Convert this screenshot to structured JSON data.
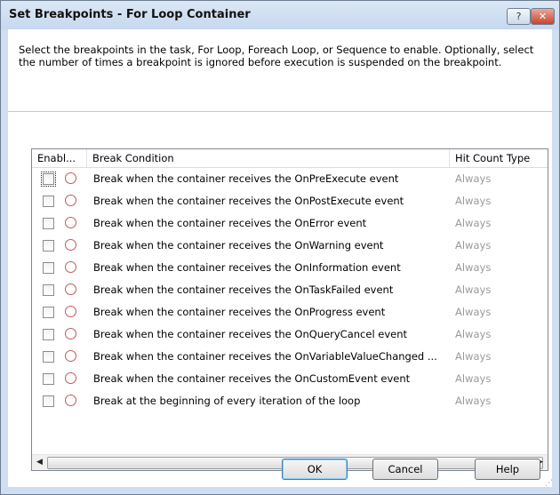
{
  "window": {
    "title": "Set Breakpoints - For Loop Container"
  },
  "titlebar": {
    "help_glyph": "?",
    "close_glyph": "✕"
  },
  "description": "Select the breakpoints in the task, For Loop, Foreach Loop, or Sequence to enable. Optionally, select the number of times a breakpoint is ignored before execution is suspended on the breakpoint.",
  "grid": {
    "columns": [
      "Enabl...",
      "Break Condition",
      "Hit Count Type"
    ],
    "rows": [
      {
        "enabled": false,
        "condition": "Break when the container receives the OnPreExecute event",
        "hit_count_type": "Always"
      },
      {
        "enabled": false,
        "condition": "Break when the container receives the OnPostExecute event",
        "hit_count_type": "Always"
      },
      {
        "enabled": false,
        "condition": "Break when the container receives the OnError event",
        "hit_count_type": "Always"
      },
      {
        "enabled": false,
        "condition": "Break when the container receives the OnWarning event",
        "hit_count_type": "Always"
      },
      {
        "enabled": false,
        "condition": "Break when the container receives the OnInformation event",
        "hit_count_type": "Always"
      },
      {
        "enabled": false,
        "condition": "Break when the container receives the OnTaskFailed event",
        "hit_count_type": "Always"
      },
      {
        "enabled": false,
        "condition": "Break when the container receives the OnProgress event",
        "hit_count_type": "Always"
      },
      {
        "enabled": false,
        "condition": "Break when the container receives the OnQueryCancel event",
        "hit_count_type": "Always"
      },
      {
        "enabled": false,
        "condition": "Break when the container receives the OnVariableValueChanged ...",
        "hit_count_type": "Always"
      },
      {
        "enabled": false,
        "condition": "Break when the container receives the OnCustomEvent event",
        "hit_count_type": "Always"
      },
      {
        "enabled": false,
        "condition": "Break at the beginning of every iteration of the loop",
        "hit_count_type": "Always"
      }
    ],
    "scroll": {
      "left": "◀",
      "right": "▶",
      "thumb_grip": "III"
    }
  },
  "buttons": {
    "ok": "OK",
    "cancel": "Cancel",
    "help": "Help"
  }
}
